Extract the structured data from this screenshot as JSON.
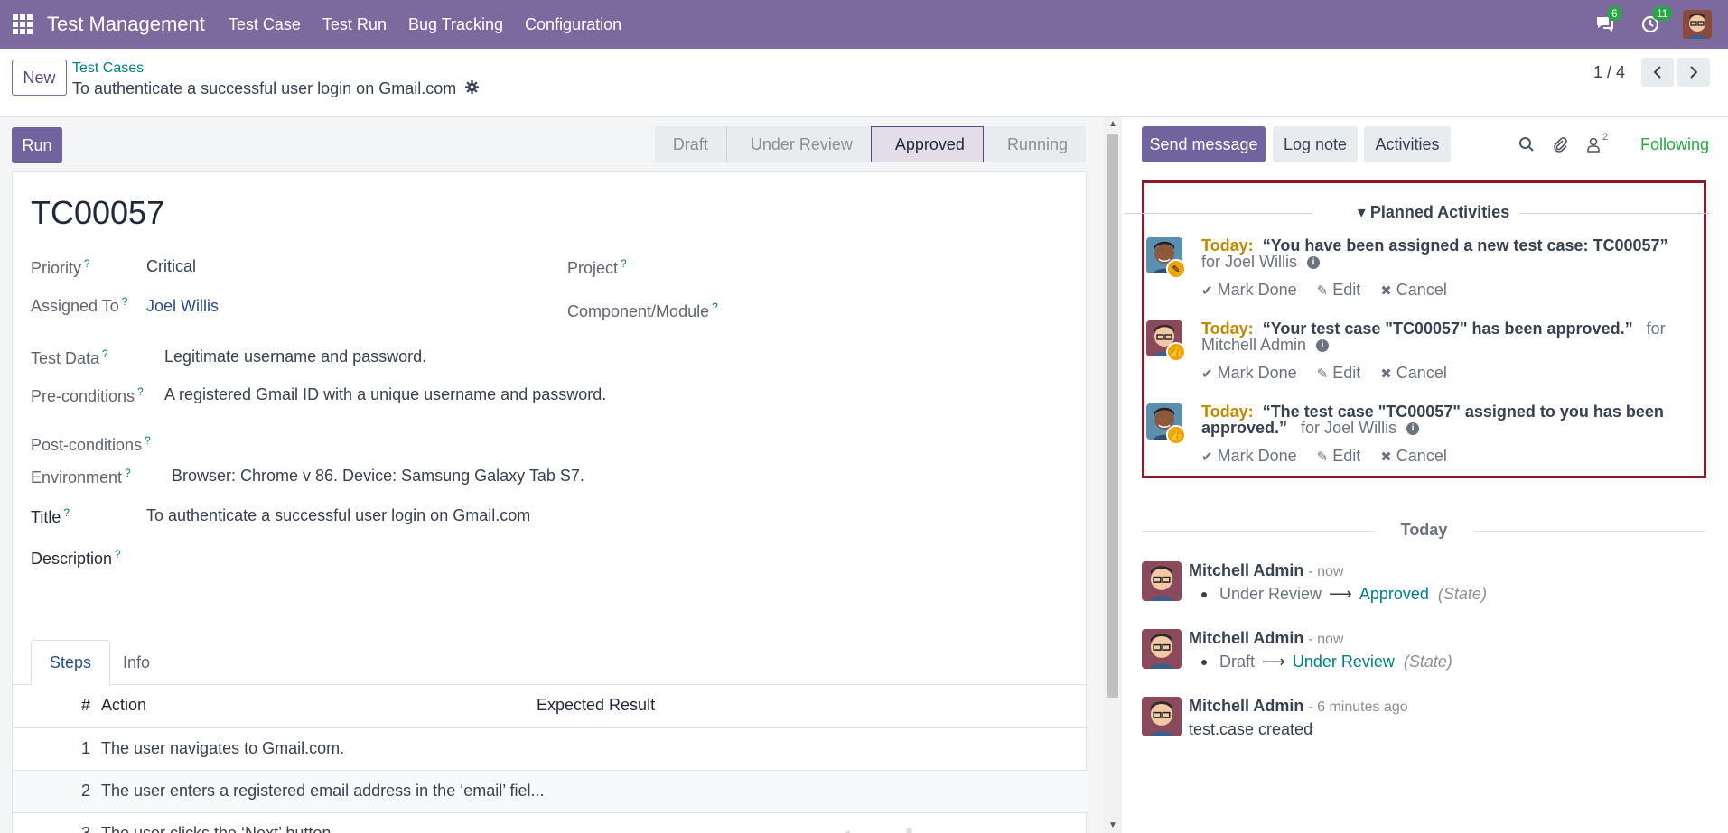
{
  "navbar": {
    "app_name": "Test Management",
    "menu": [
      "Test Case",
      "Test Run",
      "Bug Tracking",
      "Configuration"
    ],
    "messages_count": "6",
    "activities_count": "11"
  },
  "control": {
    "new_label": "New",
    "breadcrumb_parent": "Test Cases",
    "breadcrumb_current": "To authenticate a successful user login on Gmail.com",
    "pager": "1 / 4"
  },
  "form": {
    "run_label": "Run",
    "stages": [
      "Draft",
      "Under Review",
      "Approved",
      "Running"
    ],
    "active_stage": "Approved",
    "record_name": "TC00057",
    "fields": {
      "priority_label": "Priority",
      "priority_value": "Critical",
      "project_label": "Project",
      "assigned_label": "Assigned To",
      "assigned_value": "Joel Willis",
      "component_label": "Component/Module",
      "test_data_label": "Test Data",
      "test_data_value": "Legitimate username and password.",
      "preconditions_label": "Pre-conditions",
      "preconditions_value": "A registered Gmail ID with a unique username and password.",
      "postconditions_label": "Post-conditions",
      "environment_label": "Environment",
      "environment_value": "Browser: Chrome v 86. Device: Samsung Galaxy Tab S7.",
      "title_label": "Title",
      "title_value": "To authenticate a successful user login on Gmail.com",
      "description_label": "Description"
    },
    "tabs": [
      "Steps",
      "Info"
    ],
    "steps_headers": {
      "num": "#",
      "action": "Action",
      "expected": "Expected Result"
    },
    "steps": [
      {
        "num": "1",
        "action": "The user navigates to Gmail.com.",
        "expected": ""
      },
      {
        "num": "2",
        "action": "The user enters a registered email address in the ‘email’ fiel...",
        "expected": ""
      },
      {
        "num": "3",
        "action": "The user clicks the ‘Next’ button.",
        "expected": ""
      }
    ],
    "watermark": "mostaql.com"
  },
  "chatter": {
    "send_message": "Send message",
    "log_note": "Log note",
    "activities": "Activities",
    "followers_count": "2",
    "following": "Following",
    "planned_title": "Planned Activities",
    "activities_list": [
      {
        "today": "Today:",
        "summary": "“You have been assigned a new test case: TC00057”",
        "for_label": "for",
        "user": "Joel Willis"
      },
      {
        "today": "Today:",
        "summary": "“Your test case \"TC00057\" has been approved.”",
        "for_label": "for",
        "user": "Mitchell Admin"
      },
      {
        "today": "Today:",
        "summary": "“The test case \"TC00057\" assigned to you has been approved.”",
        "for_label": "for",
        "user": "Joel Willis"
      }
    ],
    "activity_actions": {
      "done": "Mark Done",
      "edit": "Edit",
      "cancel": "Cancel"
    },
    "today_separator": "Today",
    "messages": [
      {
        "author": "Mitchell Admin",
        "time": "- now",
        "old": "Under Review",
        "new": "Approved",
        "field": "(State)"
      },
      {
        "author": "Mitchell Admin",
        "time": "- now",
        "old": "Draft",
        "new": "Under Review",
        "field": "(State)"
      },
      {
        "author": "Mitchell Admin",
        "time": "- 6 minutes ago",
        "body": "test.case created"
      }
    ]
  }
}
